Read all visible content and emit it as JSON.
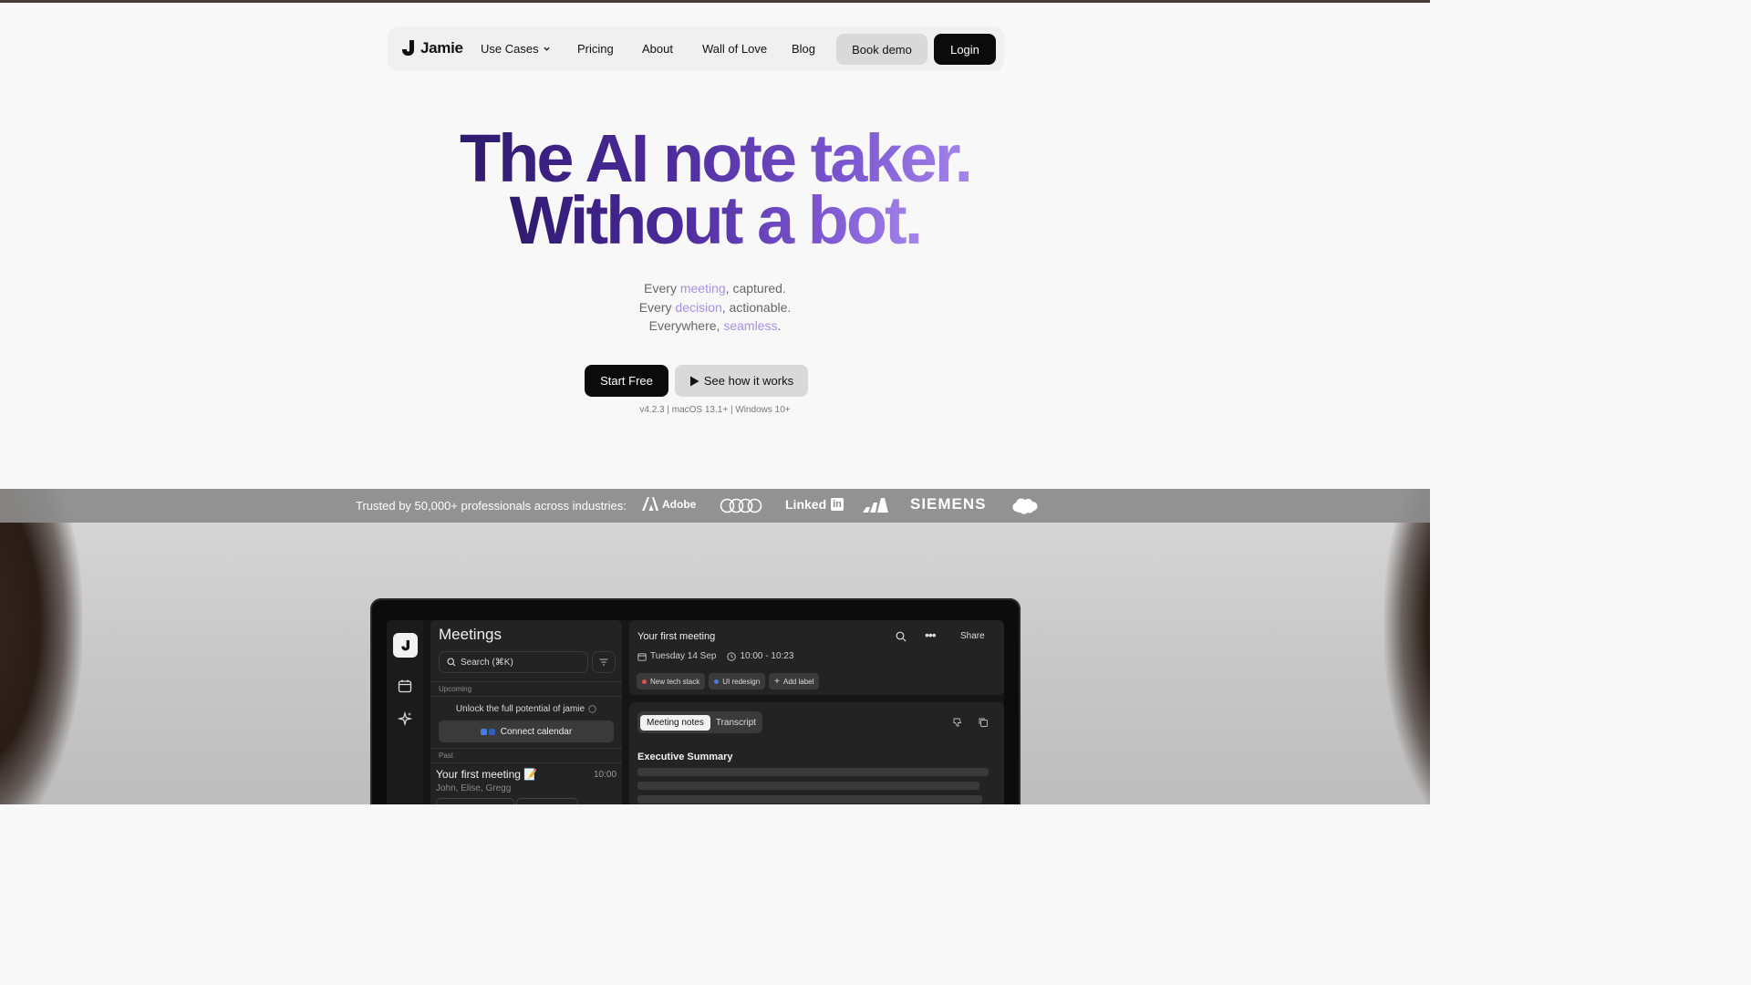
{
  "nav": {
    "brand": "Jamie",
    "links": [
      "Use Cases",
      "Pricing",
      "About",
      "Wall of Love",
      "Blog"
    ],
    "book_demo": "Book demo",
    "login": "Login"
  },
  "hero": {
    "line1": "The AI note taker.",
    "line2": "Without a bot.",
    "sub1_a": "Every ",
    "sub1_hl": "meeting",
    "sub1_b": ", captured.",
    "sub2_a": "Every ",
    "sub2_hl": "decision",
    "sub2_b": ", actionable.",
    "sub3_a": "Everywhere, ",
    "sub3_hl": "seamless",
    "sub3_b": ".",
    "start_free": "Start Free",
    "see_how": "See how it works",
    "version": "v4.2.3 | macOS 13.1+ | Windows 10+"
  },
  "trust": {
    "text": "Trusted by 50,000+ professionals across industries:",
    "adobe": "Adobe",
    "linkedin_a": "Linked",
    "linkedin_b": "in",
    "siemens": "SIEMENS",
    "salesforce": "salesforce"
  },
  "app": {
    "meetings_title": "Meetings",
    "search_placeholder": "Search (⌘K)",
    "upcoming": "Upcoming",
    "unlock": "Unlock the full potential of jamie",
    "connect": "Connect calendar",
    "past": "Past",
    "meeting_title": "Your first meeting 📝",
    "meeting_time": "10:00",
    "meeting_people": "John, Elise, Gregg",
    "detail_title": "Your first meeting",
    "share": "Share",
    "date": "Tuesday 14 Sep",
    "time_range": "10:00 - 10:23",
    "tags": [
      {
        "label": "New tech stack",
        "color": "#e0544e"
      },
      {
        "label": "UI redesign",
        "color": "#4a7be0"
      },
      {
        "label": "Add label",
        "color": ""
      }
    ],
    "tab_notes": "Meeting notes",
    "tab_transcript": "Transcript",
    "exec_summary": "Executive Summary"
  },
  "colors": {
    "accent_purple": "#a98fe6",
    "headline_dark": "#2e1a6e",
    "dark_button": "#0b0b0b"
  }
}
